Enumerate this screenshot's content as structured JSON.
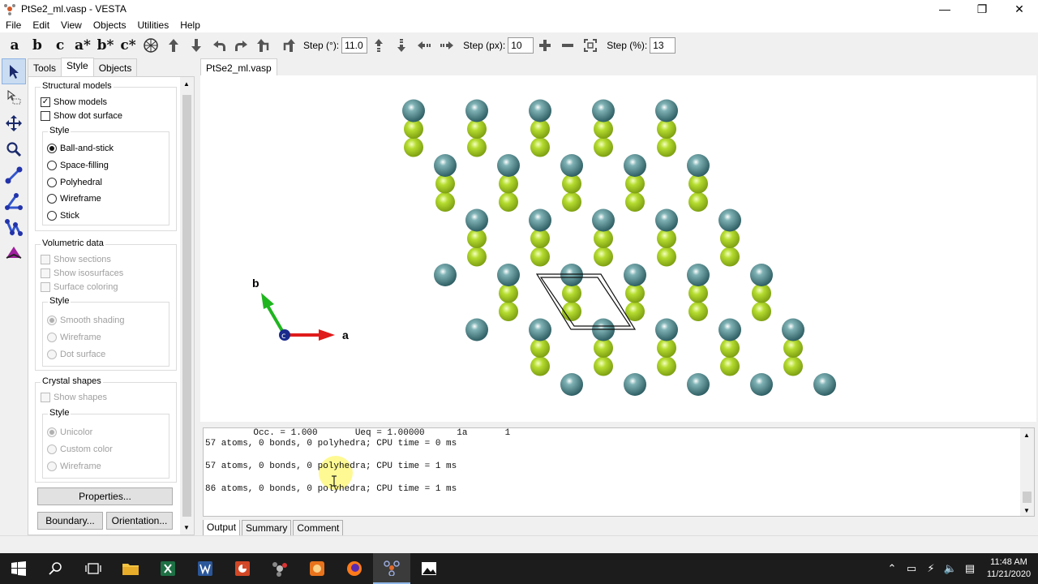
{
  "window": {
    "title": "PtSe2_ml.vasp - VESTA",
    "minimize": "—",
    "maximize": "❐",
    "close": "✕"
  },
  "menu": [
    "File",
    "Edit",
    "View",
    "Objects",
    "Utilities",
    "Help"
  ],
  "toolbar": {
    "axis_buttons": [
      "a",
      "b",
      "c",
      "a*",
      "b*",
      "c*"
    ],
    "step_deg_label": "Step (°):",
    "step_deg_value": "11.0",
    "step_px_label": "Step (px):",
    "step_px_value": "10",
    "step_pct_label": "Step (%):",
    "step_pct_value": "13"
  },
  "panel": {
    "tabs": [
      "Tools",
      "Style",
      "Objects"
    ],
    "structural": {
      "title": "Structural models",
      "show_models": "Show models",
      "show_dot_surface": "Show dot surface",
      "style_title": "Style",
      "styles": [
        "Ball-and-stick",
        "Space-filling",
        "Polyhedral",
        "Wireframe",
        "Stick"
      ]
    },
    "volumetric": {
      "title": "Volumetric data",
      "options": [
        "Show sections",
        "Show isosurfaces",
        "Surface coloring"
      ],
      "style_title": "Style",
      "styles": [
        "Smooth shading",
        "Wireframe",
        "Dot surface"
      ]
    },
    "crystal": {
      "title": "Crystal shapes",
      "show_shapes": "Show shapes",
      "style_title": "Style",
      "styles": [
        "Unicolor",
        "Custom color",
        "Wireframe"
      ]
    },
    "properties_button": "Properties...",
    "boundary_button": "Boundary...",
    "orientation_button": "Orientation..."
  },
  "document_tab": "PtSe2_ml.vasp",
  "axes": {
    "a": "a",
    "b": "b",
    "c": "c"
  },
  "colors": {
    "pt_atom": "#4c7f84",
    "se_atom": "#a9d12a",
    "axis_a": "#e01b1b",
    "axis_b": "#1fb51f",
    "axis_c": "#1a2a8c"
  },
  "output": {
    "lines": [
      "         Occ. = 1.000       Ueq = 1.00000      1a       1",
      "57 atoms, 0 bonds, 0 polyhedra; CPU time = 0 ms",
      "",
      "57 atoms, 0 bonds, 0 polyhedra; CPU time = 1 ms",
      "",
      "86 atoms, 0 bonds, 0 polyhedra; CPU time = 1 ms"
    ]
  },
  "bottom_tabs": [
    "Output",
    "Summary",
    "Comment"
  ],
  "taskbar": {
    "time": "11:48 AM",
    "date": "11/21/2020"
  }
}
